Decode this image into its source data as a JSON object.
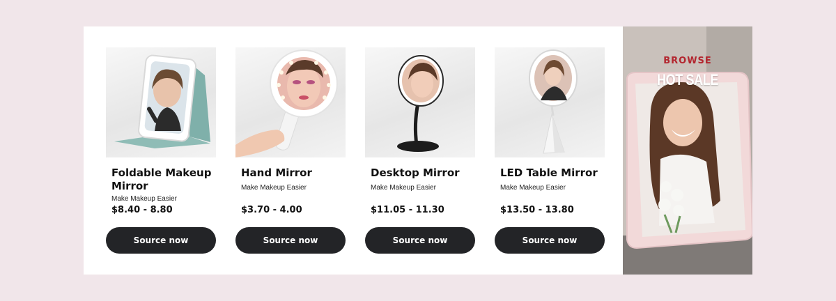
{
  "products": [
    {
      "title": "Foldable Makeup Mirror",
      "subtitle": "Make Makeup Easier",
      "price": "$8.40 - 8.80",
      "button_label": "Source now"
    },
    {
      "title": "Hand Mirror",
      "subtitle": "Make Makeup Easier",
      "price": "$3.70 - 4.00",
      "button_label": "Source now"
    },
    {
      "title": "Desktop Mirror",
      "subtitle": "Make Makeup Easier",
      "price": "$11.05 - 11.30",
      "button_label": "Source now"
    },
    {
      "title": "LED Table Mirror",
      "subtitle": "Make Makeup Easier",
      "price": "$13.50 - 13.80",
      "button_label": "Source now"
    }
  ],
  "banner": {
    "kicker": "BROWSE",
    "headline": "HOT SALE"
  },
  "colors": {
    "page_bg": "#f1e6ea",
    "button_bg": "#232427",
    "accent_red": "#b3262f"
  }
}
